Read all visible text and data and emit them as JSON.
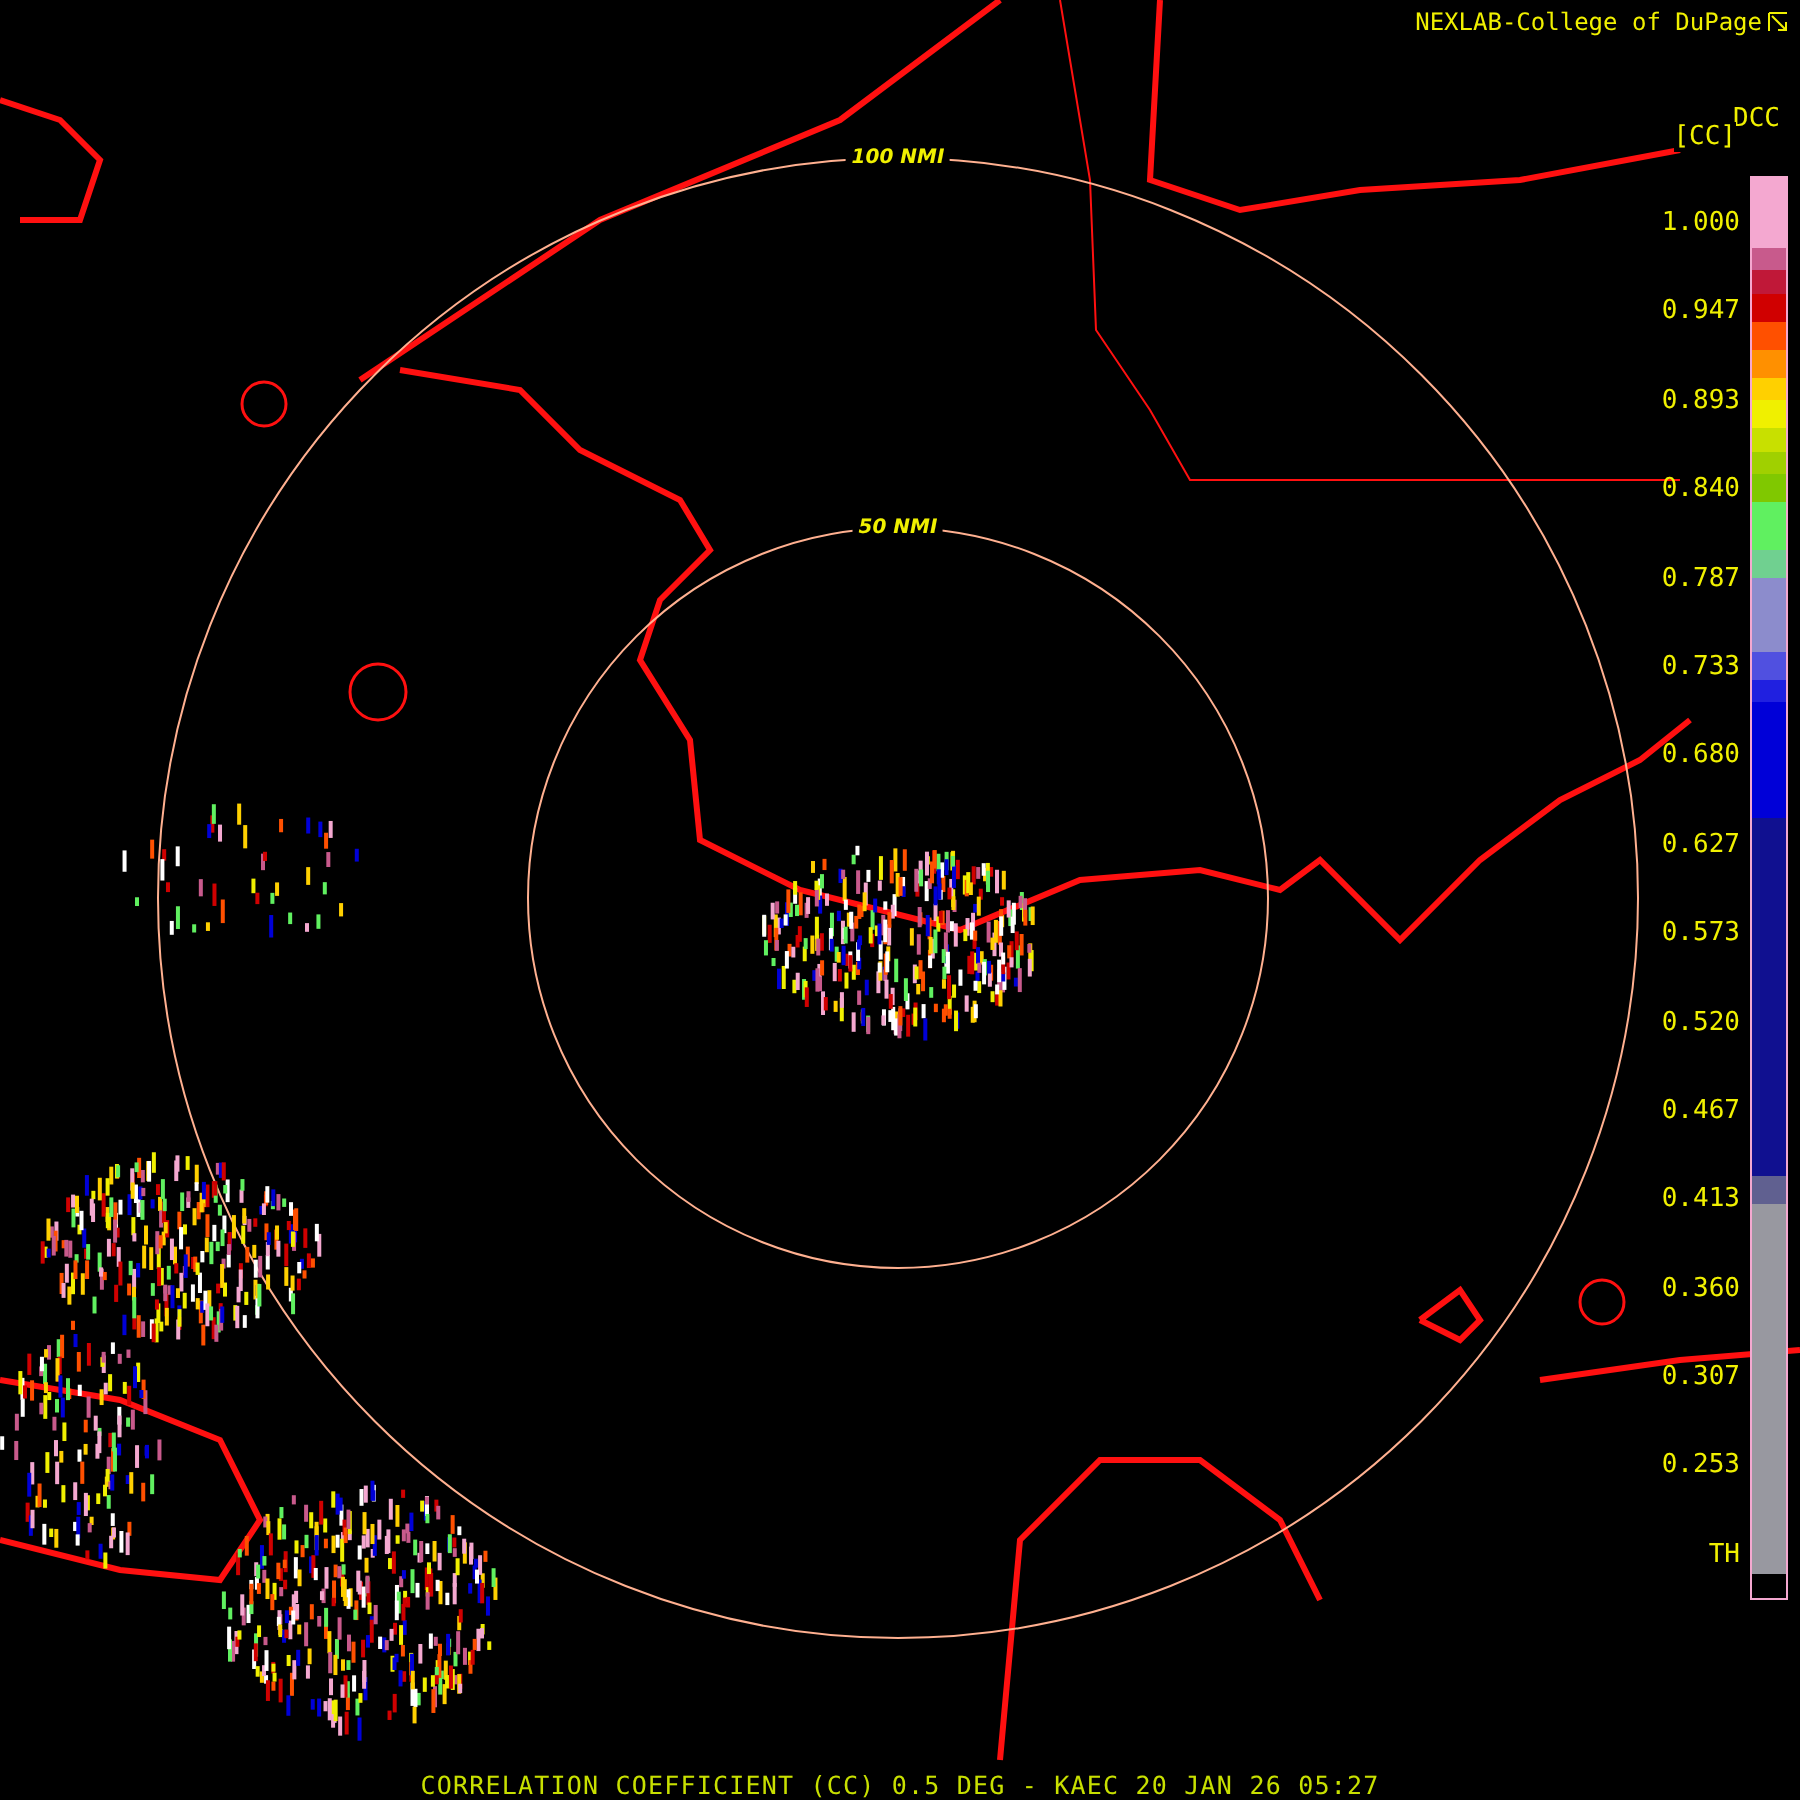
{
  "header": {
    "title": "NEXLAB-College of DuPage"
  },
  "legend": {
    "product": "DCC",
    "unit": "[CC]",
    "labels": [
      "1.000",
      "0.947",
      "0.893",
      "0.840",
      "0.787",
      "0.733",
      "0.680",
      "0.627",
      "0.573",
      "0.520",
      "0.467",
      "0.413",
      "0.360",
      "0.307",
      "0.253",
      "TH"
    ]
  },
  "range_rings": [
    {
      "label": "100 NMI"
    },
    {
      "label": "50 NMI"
    }
  ],
  "caption": "CORRELATION COEFFICIENT (CC) 0.5 DEG - KAEC 20 JAN 26 05:27"
}
